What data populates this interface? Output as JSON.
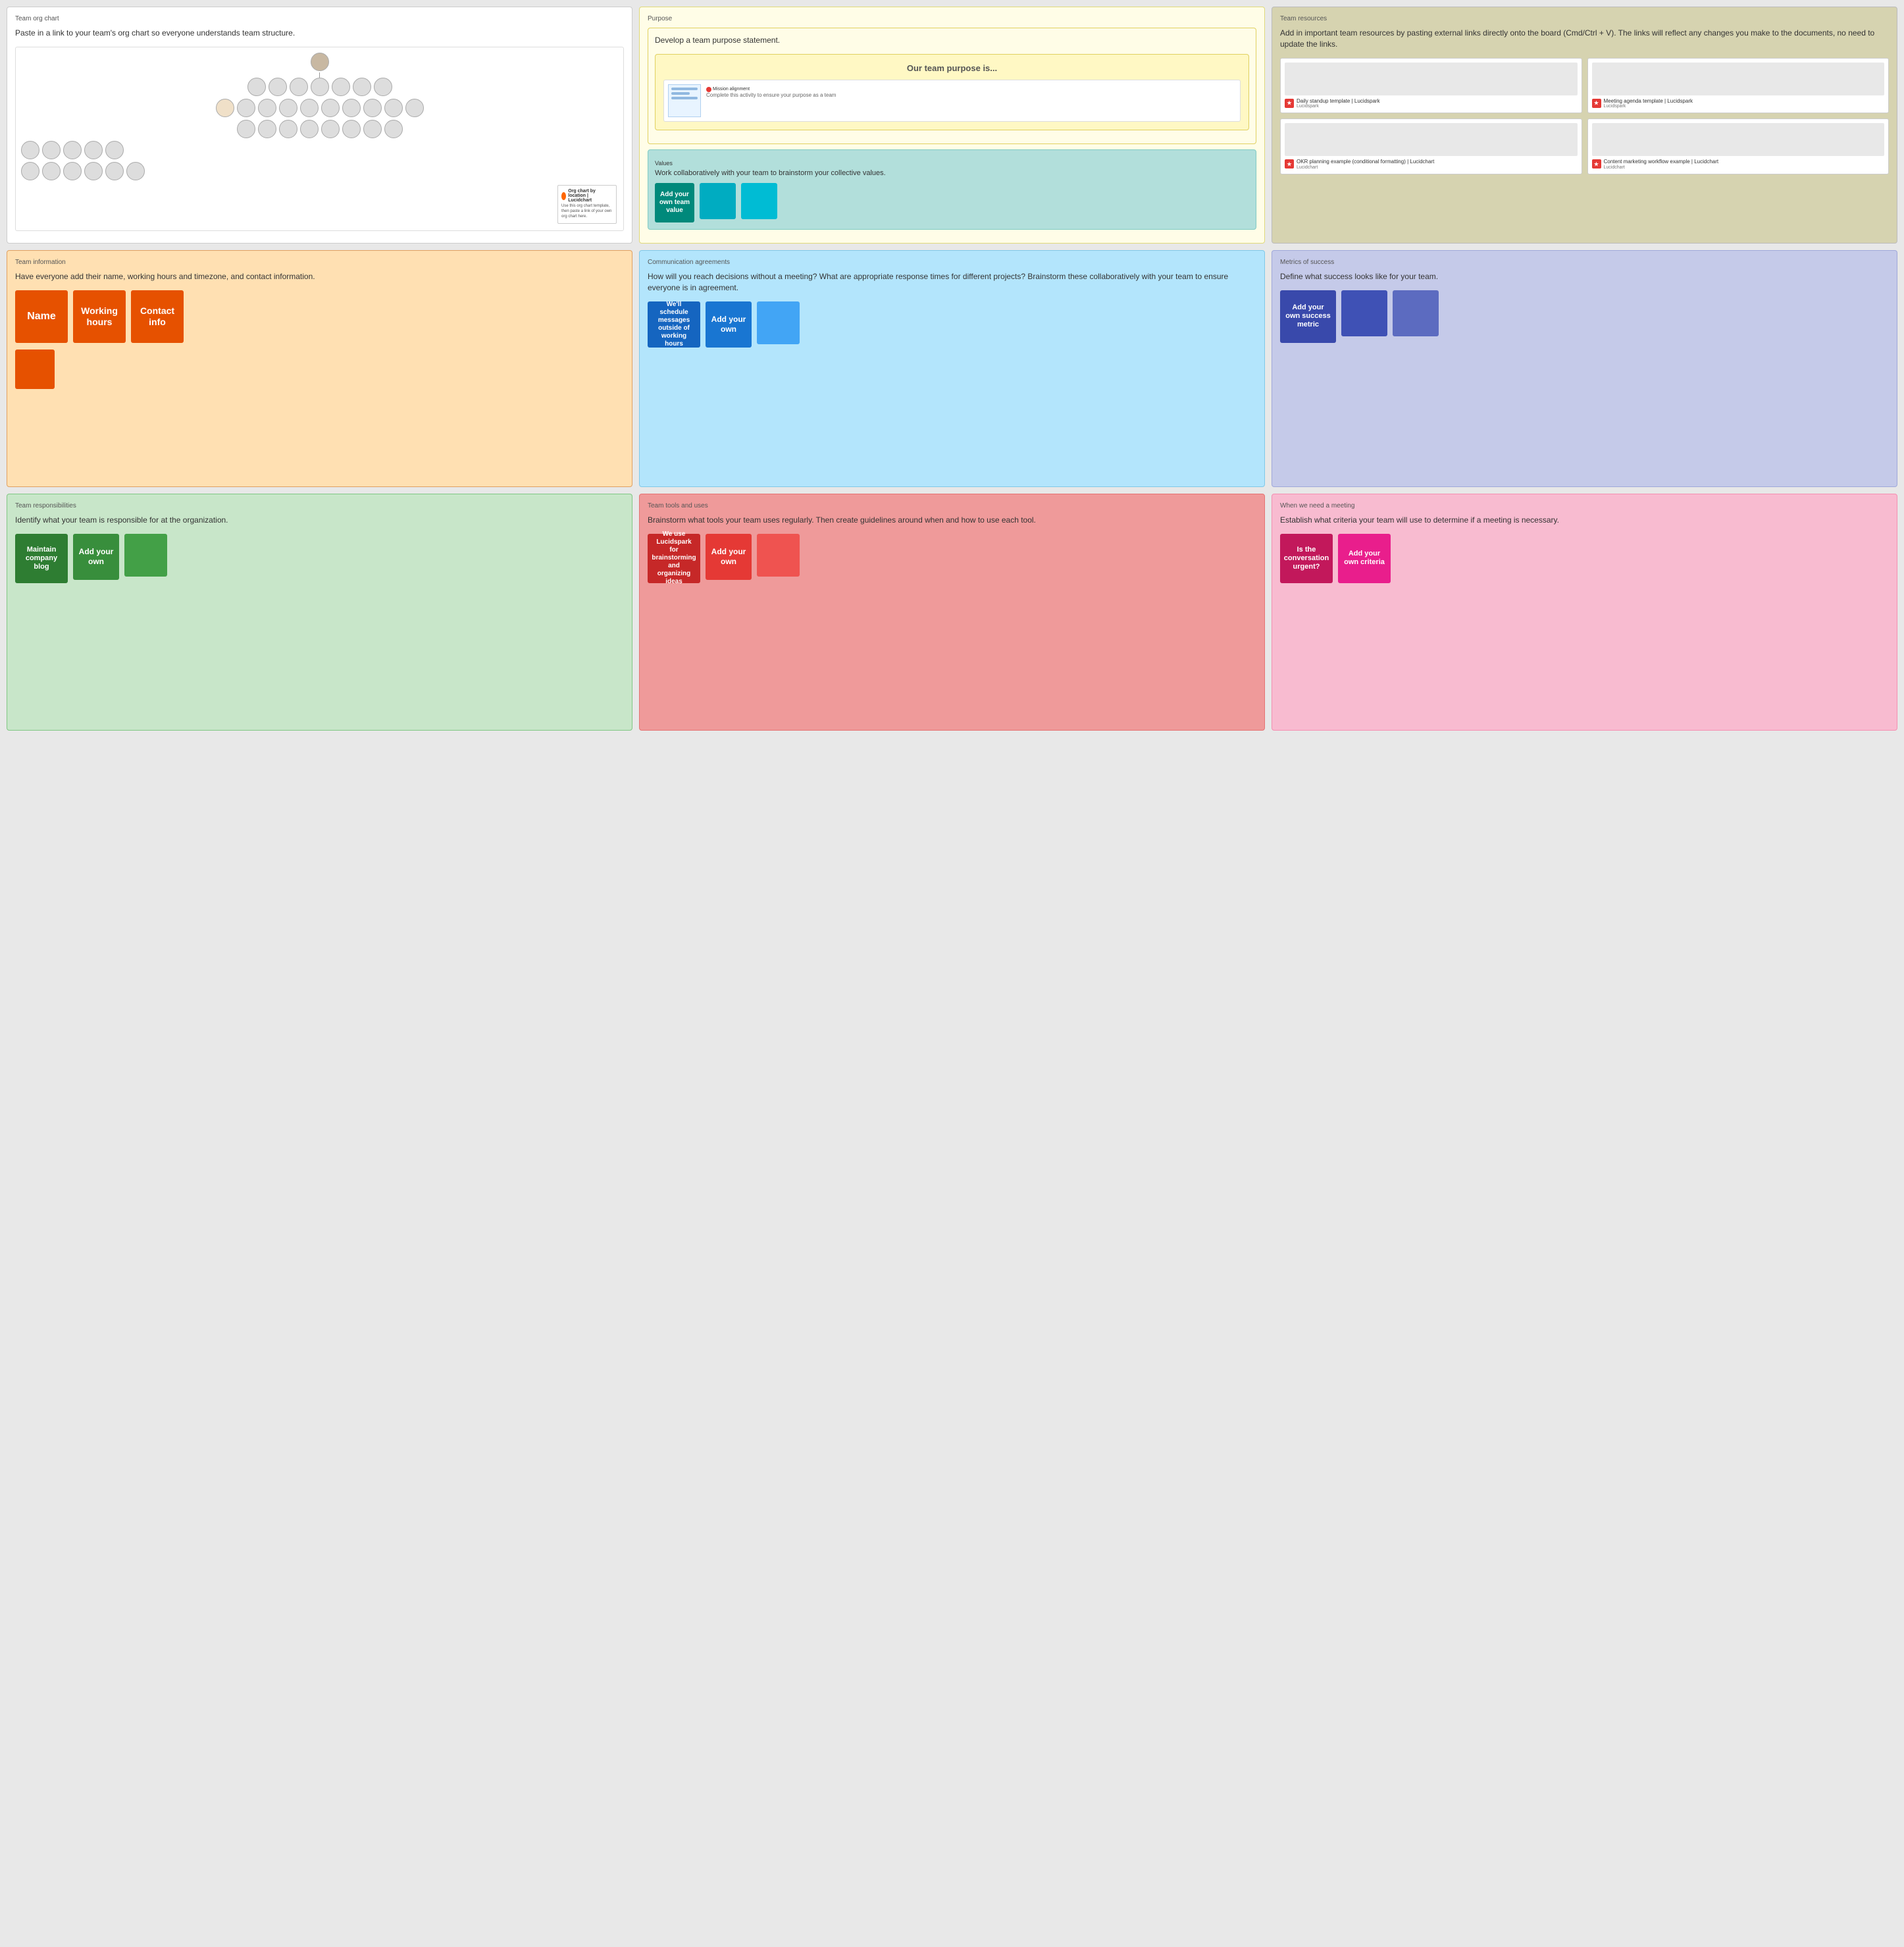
{
  "panels": {
    "org": {
      "label": "Team org chart",
      "desc": "Paste in a link to your team's org chart so everyone understands team structure."
    },
    "purpose": {
      "label": "Purpose",
      "desc": "Develop a team purpose statement.",
      "heading": "Our team purpose is...",
      "mission_label": "Mission alignment",
      "mission_text": "Complete this activity to ensure your purpose as a team"
    },
    "resources": {
      "label": "Team resources",
      "desc": "Add in important team resources by pasting external links directly onto the board (Cmd/Ctrl + V). The links will reflect any changes you make to the documents, no need to update the links.",
      "cards": [
        {
          "title": "Daily standup template | Lucidspark",
          "subtitle": "Lucidspark"
        },
        {
          "title": "Meeting agenda template | Lucidspark",
          "subtitle": "Lucidspark"
        },
        {
          "title": "OKR planning example (conditional formatting) | Lucidchart",
          "subtitle": "Lucidchart"
        },
        {
          "title": "Content marketing workflow example | Lucidchart",
          "subtitle": "Lucidchart"
        }
      ]
    },
    "info": {
      "label": "Team information",
      "desc": "Have everyone add their name, working hours and timezone, and contact information.",
      "stickies": [
        {
          "text": "Name",
          "color": "#e65100",
          "size": "large"
        },
        {
          "text": "Working hours",
          "color": "#e65100",
          "size": "large"
        },
        {
          "text": "Contact info",
          "color": "#e65100",
          "size": "large"
        },
        {
          "text": "",
          "color": "#e65100",
          "size": "small"
        }
      ]
    },
    "comm": {
      "label": "Communication agreements",
      "desc": "How will you reach decisions without a meeting? What are appropriate response times for different projects? Brainstorm these collaboratively with your team to ensure everyone is in agreement.",
      "stickies": [
        {
          "text": "We'll schedule messages outside of working hours",
          "color": "#1565c0"
        },
        {
          "text": "Add your own",
          "color": "#1976d2"
        },
        {
          "text": "",
          "color": "#42a5f5"
        }
      ]
    },
    "metrics": {
      "label": "Metrics of success",
      "desc": "Define what success looks like for your team.",
      "stickies": [
        {
          "text": "Add your own success metric",
          "color": "#3949ab"
        },
        {
          "text": "",
          "color": "#3f51b5"
        },
        {
          "text": "",
          "color": "#5c6bc0"
        }
      ]
    },
    "resp": {
      "label": "Team responsibilities",
      "desc": "Identify what your team is responsible for at the organization.",
      "stickies": [
        {
          "text": "Maintain company blog",
          "color": "#2e7d32"
        },
        {
          "text": "Add your own",
          "color": "#388e3c"
        },
        {
          "text": "",
          "color": "#43a047"
        }
      ]
    },
    "tools": {
      "label": "Team tools and uses",
      "desc": "Brainstorm what tools your team uses regularly. Then create guidelines around when and how to use each tool.",
      "stickies": [
        {
          "text": "We use Lucidspark for brainstorming and organizing ideas",
          "color": "#c62828"
        },
        {
          "text": "Add your own",
          "color": "#e53935"
        },
        {
          "text": "",
          "color": "#ef5350"
        }
      ]
    },
    "meeting": {
      "label": "When we need a meeting",
      "desc": "Establish what criteria your team will use to determine if a meeting is necessary.",
      "stickies": [
        {
          "text": "Is the conversation urgent?",
          "color": "#c2185b"
        },
        {
          "text": "Add your own criteria",
          "color": "#e91e8c"
        }
      ]
    }
  },
  "values": {
    "label": "Values",
    "desc": "Work collaboratively with your team to brainstorm your collective values.",
    "stickies": [
      {
        "text": "Add your own team value",
        "color": "#00897b"
      },
      {
        "text": "",
        "color": "#00acc1"
      },
      {
        "text": "",
        "color": "#00bcd4"
      }
    ]
  }
}
